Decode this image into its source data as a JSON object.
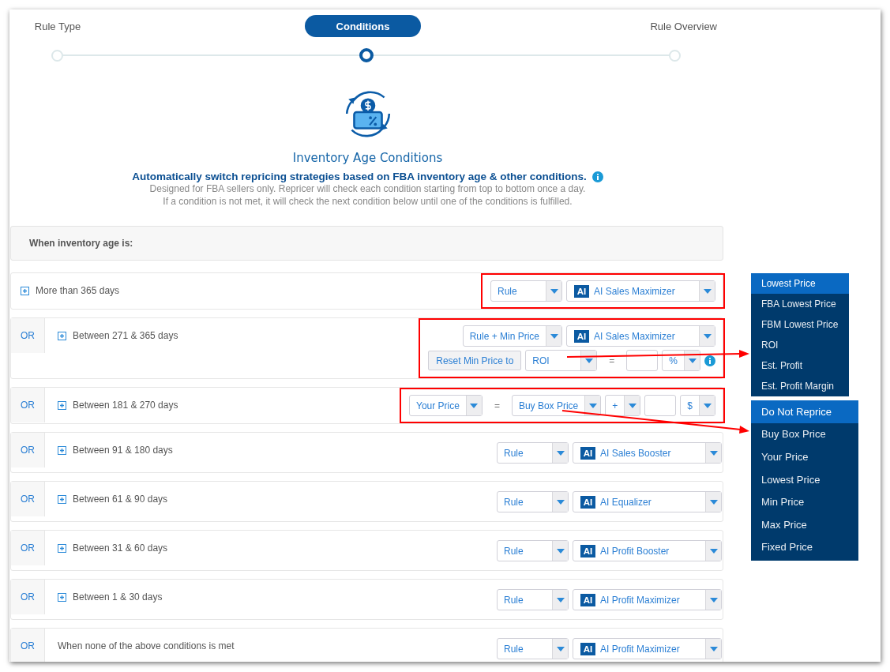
{
  "steps": [
    {
      "label": "Rule Type",
      "selected": false
    },
    {
      "label": "Conditions",
      "selected": true
    },
    {
      "label": "Rule Overview",
      "selected": false
    }
  ],
  "intro": {
    "title": "Inventory Age Conditions",
    "subtitle": "Automatically switch repricing strategies based on FBA inventory age & other conditions.",
    "description": [
      "Designed for FBA sellers only. Repricer will check each condition starting from top to bottom once a day.",
      "If a condition is not met, it will check the next condition below until one of the conditions is fulfilled."
    ]
  },
  "conditions_header": "When inventory age is:",
  "rows": [
    {
      "label": "More than 365 days",
      "expandable": true,
      "highlighted": true,
      "lines": [
        [
          {
            "kind": "select",
            "value": "Rule"
          },
          {
            "kind": "strategy",
            "badge": "AI",
            "value": "AI Sales Maximizer"
          }
        ]
      ]
    },
    {
      "connector": "OR",
      "label": "Between 271 & 365 days",
      "expandable": true,
      "highlighted": true,
      "lines": [
        [
          {
            "kind": "select",
            "value": "Rule + Min Price"
          },
          {
            "kind": "strategy",
            "badge": "AI",
            "value": "AI Sales Maximizer"
          }
        ],
        [
          {
            "kind": "button",
            "value": "Reset Min Price to"
          },
          {
            "kind": "select",
            "value": "ROI"
          },
          {
            "kind": "operator",
            "value": "="
          },
          {
            "kind": "input"
          },
          {
            "kind": "select",
            "value": "%"
          },
          {
            "kind": "info"
          }
        ]
      ]
    },
    {
      "connector": "OR",
      "label": "Between 181 & 270 days",
      "expandable": true,
      "highlighted": true,
      "lines": [
        [
          {
            "kind": "select",
            "value": "Your Price"
          },
          {
            "kind": "operator",
            "value": "="
          },
          {
            "kind": "select",
            "value": "Buy Box Price"
          },
          {
            "kind": "select",
            "value": "+"
          },
          {
            "kind": "input"
          },
          {
            "kind": "select",
            "value": "$"
          }
        ]
      ]
    },
    {
      "connector": "OR",
      "label": "Between 91 & 180 days",
      "expandable": true,
      "highlighted": false,
      "lines": [
        [
          {
            "kind": "select",
            "value": "Rule"
          },
          {
            "kind": "strategy",
            "badge": "AI",
            "value": "AI Sales Booster"
          }
        ]
      ]
    },
    {
      "connector": "OR",
      "label": "Between 61 & 90 days",
      "expandable": true,
      "highlighted": false,
      "lines": [
        [
          {
            "kind": "select",
            "value": "Rule"
          },
          {
            "kind": "strategy",
            "badge": "AI",
            "value": "AI Equalizer"
          }
        ]
      ]
    },
    {
      "connector": "OR",
      "label": "Between 31 & 60 days",
      "expandable": true,
      "highlighted": false,
      "lines": [
        [
          {
            "kind": "select",
            "value": "Rule"
          },
          {
            "kind": "strategy",
            "badge": "AI",
            "value": "AI Profit Booster"
          }
        ]
      ]
    },
    {
      "connector": "OR",
      "label": "Between 1 & 30 days",
      "expandable": true,
      "highlighted": false,
      "lines": [
        [
          {
            "kind": "select",
            "value": "Rule"
          },
          {
            "kind": "strategy",
            "badge": "AI",
            "value": "AI Profit Maximizer"
          }
        ]
      ]
    },
    {
      "connector": "OR",
      "label": "When none of the above conditions is met",
      "expandable": false,
      "highlighted": false,
      "lines": [
        [
          {
            "kind": "select",
            "value": "Rule"
          },
          {
            "kind": "strategy",
            "badge": "AI",
            "value": "AI Profit Maximizer"
          }
        ]
      ]
    }
  ],
  "menus": [
    {
      "items": [
        {
          "label": "Lowest Price",
          "selected": true
        },
        {
          "label": "FBA Lowest Price",
          "selected": false
        },
        {
          "label": "FBM Lowest Price",
          "selected": false
        },
        {
          "label": "ROI",
          "selected": false
        },
        {
          "label": "Est. Profit",
          "selected": false
        },
        {
          "label": "Est. Profit Margin",
          "selected": false
        }
      ]
    },
    {
      "items": [
        {
          "label": "Do Not Reprice",
          "selected": true
        },
        {
          "label": "Buy Box Price",
          "selected": false
        },
        {
          "label": "Your Price",
          "selected": false
        },
        {
          "label": "Lowest Price",
          "selected": false
        },
        {
          "label": "Min Price",
          "selected": false
        },
        {
          "label": "Max Price",
          "selected": false
        },
        {
          "label": "Fixed Price",
          "selected": false
        }
      ]
    }
  ]
}
